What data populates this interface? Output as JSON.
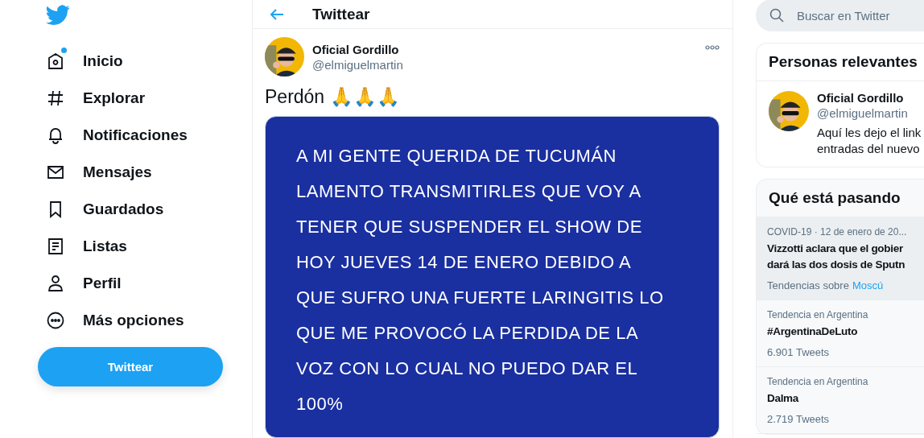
{
  "nav": {
    "items": [
      {
        "kind": "home",
        "label": "Inicio",
        "badge": true
      },
      {
        "kind": "explore",
        "label": "Explorar",
        "badge": false
      },
      {
        "kind": "bell",
        "label": "Notificaciones",
        "badge": false
      },
      {
        "kind": "mail",
        "label": "Mensajes",
        "badge": false
      },
      {
        "kind": "bookmark",
        "label": "Guardados",
        "badge": false
      },
      {
        "kind": "list",
        "label": "Listas",
        "badge": false
      },
      {
        "kind": "person",
        "label": "Perfil",
        "badge": false
      },
      {
        "kind": "more",
        "label": "Más opciones",
        "badge": false
      }
    ],
    "tweet_button": "Twittear"
  },
  "header": {
    "title": "Twittear"
  },
  "tweet": {
    "author": "Oficial Gordillo",
    "handle": "@elmiguelmartin",
    "text": "Perdón 🙏🙏🙏",
    "media": {
      "lines": [
        "A MI GENTE QUERIDA DE TUCUMÁN",
        "LAMENTO TRANSMITIRLES QUE VOY A",
        "TENER QUE SUSPENDER EL SHOW DE",
        "HOY JUEVES 14 DE ENERO DEBIDO A",
        "QUE SUFRO UNA FUERTE LARINGITIS LO",
        "QUE ME PROVOCÓ LA PERDIDA DE LA",
        "VOZ CON LO CUAL NO PUEDO DAR EL",
        "100%"
      ]
    }
  },
  "search": {
    "placeholder": "Buscar en Twitter"
  },
  "relevant": {
    "title": "Personas relevantes",
    "person": {
      "name": "Oficial Gordillo",
      "handle": "@elmiguelmartin",
      "bio": [
        "Aquí les dejo el link",
        "entradas del nuevo"
      ]
    }
  },
  "trends": {
    "title": "Qué está pasando",
    "items": [
      {
        "kind": "news",
        "meta": "COVID-19 · 12 de enero de 20...",
        "title": "Vizzotti aclara que el gobier\ndará las dos dosis de Sputn",
        "footer": "Tendencias sobre",
        "link": "Moscú"
      },
      {
        "kind": "trend",
        "meta": "Tendencia en Argentina",
        "title": "#ArgentinaDeLuto",
        "footer": "6.901 Tweets"
      },
      {
        "kind": "trend",
        "meta": "Tendencia en Argentina",
        "title": "Dalma",
        "footer": "2.719 Tweets"
      }
    ]
  }
}
